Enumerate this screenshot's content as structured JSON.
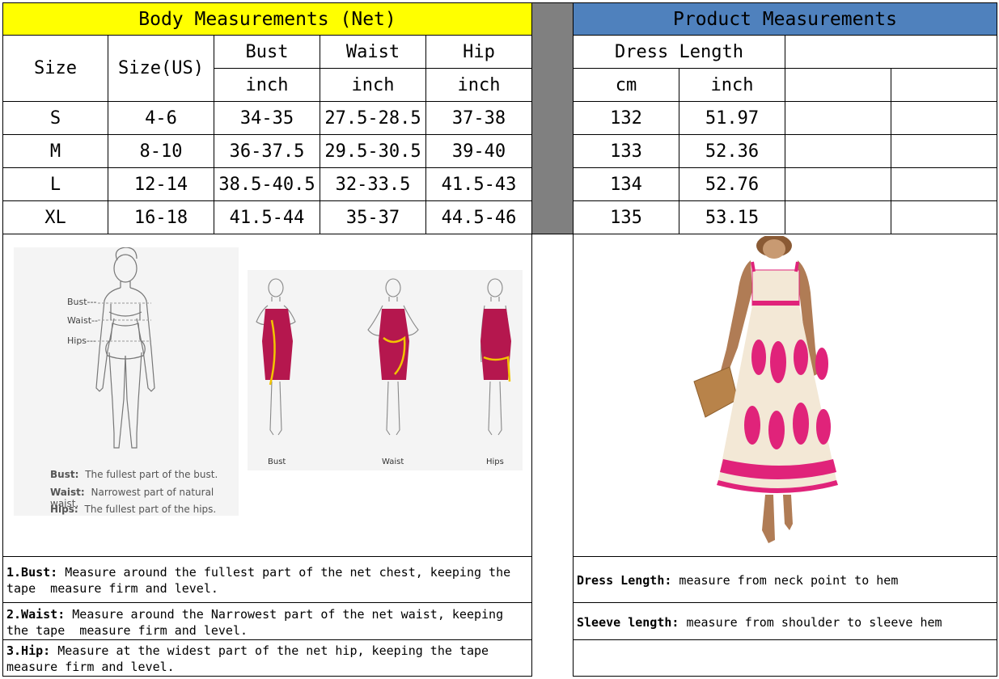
{
  "body_table": {
    "title": "Body Measurements (Net)",
    "col_size": "Size",
    "col_size_us": "Size(US)",
    "col_bust": "Bust",
    "col_waist": "Waist",
    "col_hip": "Hip",
    "unit_inch": "inch",
    "rows": [
      {
        "size": "S",
        "us": "4-6",
        "bust": "34-35",
        "waist": "27.5-28.5",
        "hip": "37-38"
      },
      {
        "size": "M",
        "us": "8-10",
        "bust": "36-37.5",
        "waist": "29.5-30.5",
        "hip": "39-40"
      },
      {
        "size": "L",
        "us": "12-14",
        "bust": "38.5-40.5",
        "waist": "32-33.5",
        "hip": "41.5-43"
      },
      {
        "size": "XL",
        "us": "16-18",
        "bust": "41.5-44",
        "waist": "35-37",
        "hip": "44.5-46"
      }
    ]
  },
  "product_table": {
    "title": "Product Measurements",
    "col_dress_length": "Dress Length",
    "unit_cm": "cm",
    "unit_inch": "inch",
    "rows": [
      {
        "cm": "132",
        "inch": "51.97"
      },
      {
        "cm": "133",
        "inch": "52.36"
      },
      {
        "cm": "134",
        "inch": "52.76"
      },
      {
        "cm": "135",
        "inch": "53.15"
      }
    ]
  },
  "diagram": {
    "label_bust": "Bust---",
    "label_waist": "Waist--",
    "label_hips": "Hips---",
    "def_bust_term": "Bust:",
    "def_bust_text": "The fullest part of the bust.",
    "def_waist_term": "Waist:",
    "def_waist_text": "Narrowest part of natural waist.",
    "def_hips_term": "Hips:",
    "def_hips_text": "The fullest part of the hips.",
    "fig_bust": "Bust",
    "fig_waist": "Waist",
    "fig_hips": "Hips"
  },
  "notes": {
    "bust_term": "1.Bust:",
    "bust_text": " Measure around the fullest part of the net chest, keeping the tape  measure firm and level.",
    "waist_term": "2.Waist:",
    "waist_text": " Measure around the Narrowest part of the net waist, keeping the tape  measure firm and level.",
    "hip_term": "3.Hip:",
    "hip_text": " Measure at the widest part of the net hip, keeping the tape measure firm and level.",
    "dress_term": "Dress Length:",
    "dress_text": " measure from neck point to hem",
    "sleeve_term": "Sleeve length:",
    "sleeve_text": " measure from shoulder to sleeve hem"
  },
  "colors": {
    "header_left": "#ffff00",
    "header_right": "#4f81bd",
    "divider": "#808080",
    "dress_print": "#e0237a",
    "dress_base": "#f3e8d6"
  }
}
